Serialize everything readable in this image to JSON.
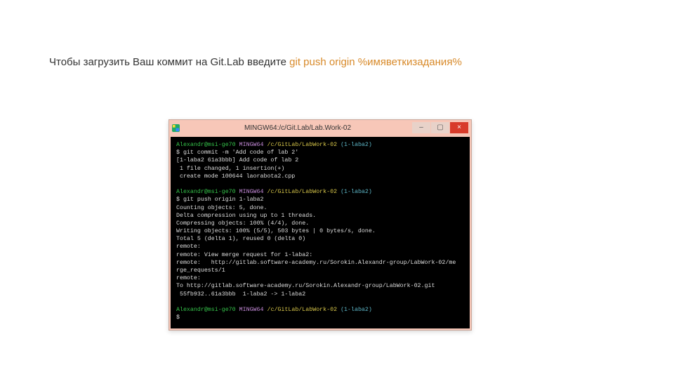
{
  "heading": {
    "text_before": "Чтобы загрузить Ваш коммит на Git.Lab введите ",
    "command": "git push origin %имяветкизадания%"
  },
  "window": {
    "title": "MINGW64:/c/Git.Lab/Lab.Work-02",
    "minimize": "–",
    "maximize": "▢",
    "close": "×"
  },
  "prompt": {
    "user_host": "Alexandr@msi-ge70",
    "shell": "MINGW64",
    "path": "/c/GitLab/LabWork-02",
    "branch": "(1-laba2)"
  },
  "block1": {
    "cmd": " git commit -m 'Add code of lab 2'",
    "lines": [
      "[1-laba2 61a3bbb] Add code of lab 2",
      " 1 file changed, 1 insertion(+)",
      " create mode 100644 laorabota2.cpp"
    ]
  },
  "block2": {
    "cmd": " git push origin 1-laba2",
    "lines": [
      "Counting objects: 5, done.",
      "Delta compression using up to 1 threads.",
      "Compressing objects: 100% (4/4), done.",
      "Writing objects: 100% (5/5), 503 bytes | 0 bytes/s, done.",
      "Total 5 (delta 1), reused 0 (delta 0)",
      "remote:",
      "remote: View merge request for 1-laba2:",
      "remote:   http://gitlab.software-academy.ru/Sorokin.Alexandr-group/LabWork-02/me",
      "rge_requests/1",
      "remote:",
      "To http://gitlab.software-academy.ru/Sorokin.Alexandr-group/LabWork-02.git",
      " 55fb932..61a3bbb  1-laba2 -> 1-laba2"
    ]
  },
  "block3": {
    "cursor": "$"
  }
}
